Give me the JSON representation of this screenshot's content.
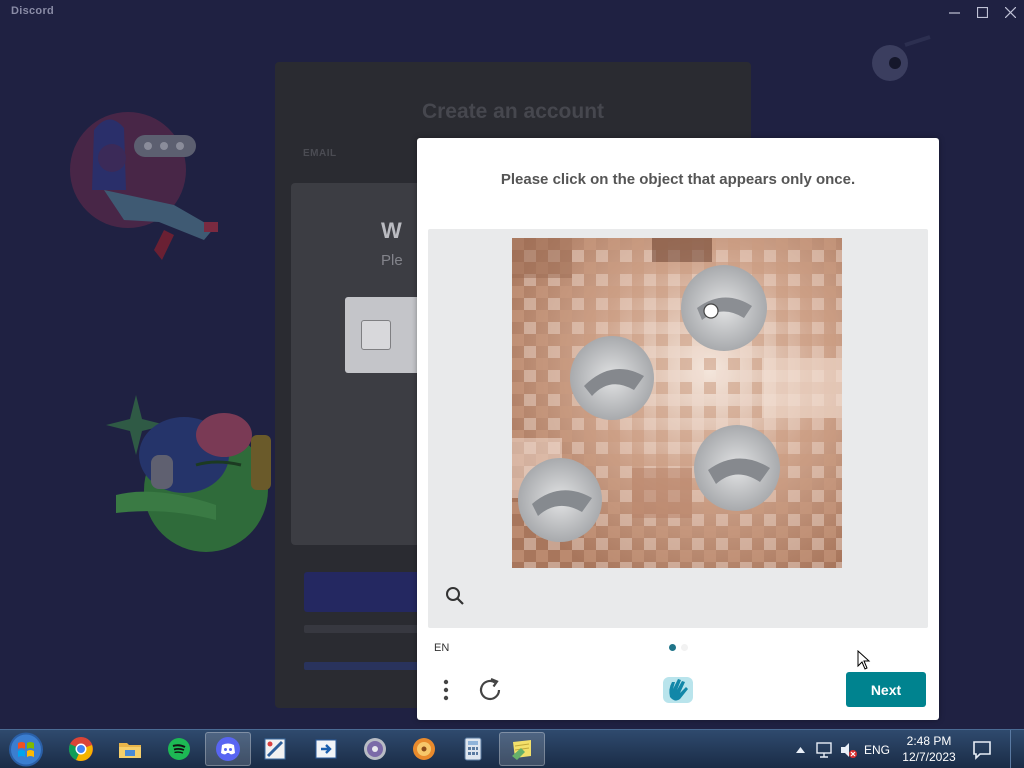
{
  "window": {
    "title": "Discord"
  },
  "register": {
    "title": "Create an account",
    "email_label": "EMAIL",
    "verify_heading": "W",
    "verify_sub": "Ple"
  },
  "challenge": {
    "prompt": "Please click on the object that appears only once.",
    "language": "EN",
    "next_label": "Next",
    "page_count": 2,
    "current_page": 1
  },
  "taskbar": {
    "apps": [
      {
        "name": "Google Chrome",
        "icon": "chrome-icon"
      },
      {
        "name": "File Explorer",
        "icon": "folder-icon"
      },
      {
        "name": "Spotify",
        "icon": "spotify-icon"
      },
      {
        "name": "Discord",
        "icon": "discord-icon",
        "active": true
      },
      {
        "name": "Paint",
        "icon": "paint-icon"
      },
      {
        "name": "Remote app",
        "icon": "remote-icon"
      },
      {
        "name": "DVD Player",
        "icon": "dvd-icon"
      },
      {
        "name": "Media Player",
        "icon": "media-icon"
      },
      {
        "name": "Calculator",
        "icon": "calculator-icon"
      },
      {
        "name": "Sticky Notes",
        "icon": "notes-icon"
      }
    ],
    "language": "ENG",
    "time": "2:48 PM",
    "date": "12/7/2023"
  },
  "colors": {
    "accent": "#00838f",
    "discord_bg": "#1f2142",
    "taskbar": "#1a2c46"
  }
}
